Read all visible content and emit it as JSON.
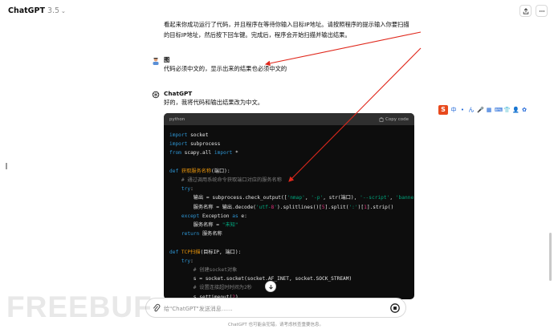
{
  "header": {
    "model_name": "ChatGPT",
    "model_version": "3.5",
    "share_icon": "share-icon",
    "more_icon": "dots-icon"
  },
  "messages": {
    "assistant_prev_line1": "看起来你成功运行了代码，并且程序在等待你输入目标IP地址。请按照程序的提示输入你要扫描",
    "assistant_prev_line2": "的目标IP地址，然后按下回车键。完成后，程序会开始扫描并输出结果。",
    "user_name": "图",
    "user_message": "代码必须中文的，显示出来的结果也必须中文的",
    "assistant_name": "ChatGPT",
    "assistant_reply": "好的，我将代码和输出结果改为中文。"
  },
  "code_block": {
    "language": "python",
    "copy_label": "Copy code",
    "lines": [
      "import socket",
      "import subprocess",
      "from scapy.all import *",
      "",
      "def 获取服务名称(端口):",
      "    # 通过调用系统命令获取端口对应的服务名称",
      "    try:",
      "        输出 = subprocess.check_output(['nmap', '-p', str(端口), '--script', 'banner',",
      "        服务名称 = 输出.decode('utf-8').splitlines()[5].split(':')[1].strip()",
      "    except Exception as e:",
      "        服务名称 = \"未知\"",
      "    return 服务名称",
      "",
      "def TCP扫描(目标IP, 端口):",
      "    try:",
      "        # 创建socket对象",
      "        s = socket.socket(socket.AF_INET, socket.SOCK_STREAM)",
      "        # 设置连接超时时间为2秒",
      "        s.settimeout(2)",
      "        # 尝试连接目标IP和端口",
      "        s.connect((目标IP, 端口))"
    ]
  },
  "composer": {
    "placeholder": "给\"ChatGPT\"发送消息……",
    "footer": "ChatGPT 也可能会犯错。请考虑核查重要信息。"
  },
  "translator_toolbar": {
    "logo_text": "S",
    "items": [
      "中",
      "•",
      "ん",
      "🎤",
      "▦",
      "⌨",
      "👕",
      "👤",
      "✿"
    ]
  },
  "watermark": "FREEBUF",
  "colors": {
    "code_bg": "#0d0d0d",
    "code_header": "#2f2f2f",
    "arrow": "#e0281c",
    "keyword": "#2e95d3",
    "function": "#e9950c",
    "string": "#00a67d"
  }
}
